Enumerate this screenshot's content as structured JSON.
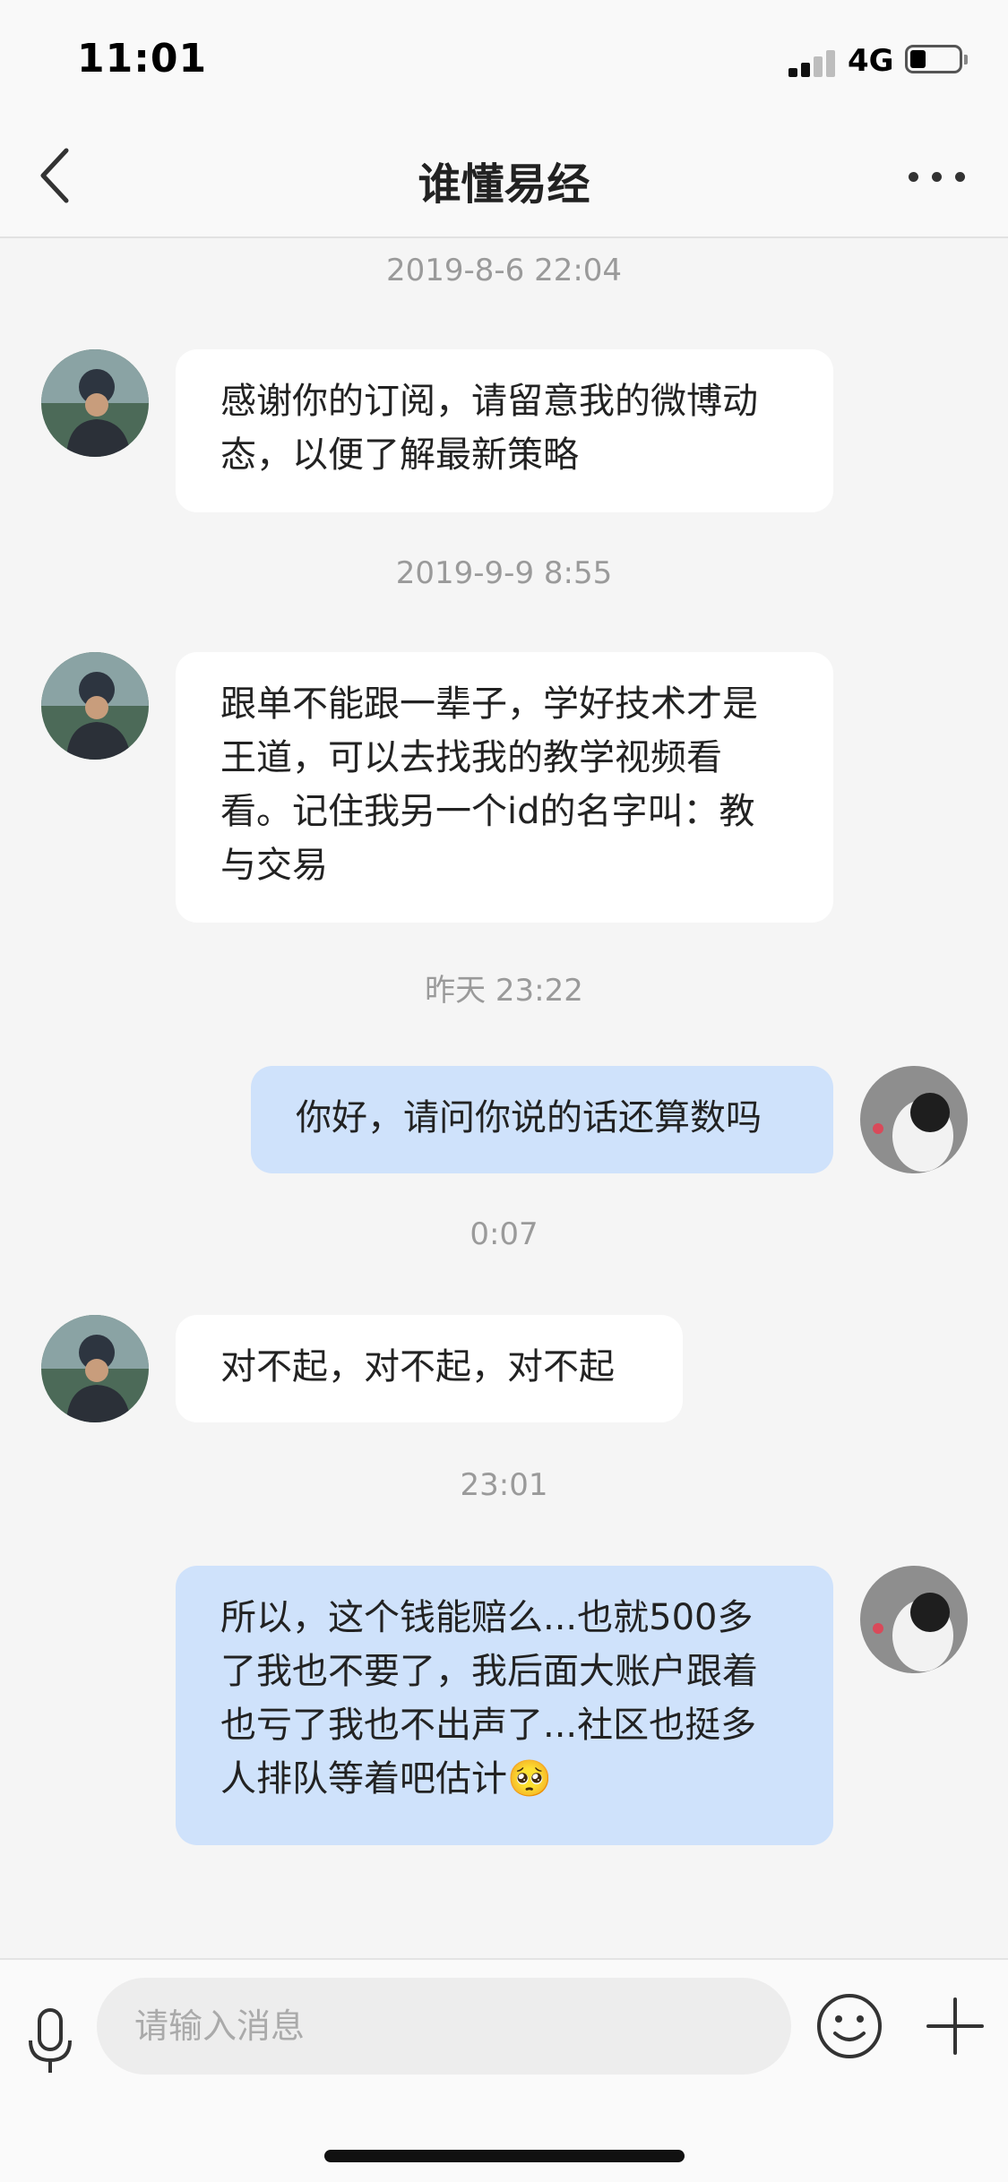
{
  "status_bar": {
    "time": "11:01",
    "network": "4G"
  },
  "nav": {
    "title": "谁懂易经"
  },
  "messages": [
    {
      "timestamp": "2019-8-6 22:04",
      "side": "left",
      "lines": [
        "感谢你的订阅，请留意我的微博动",
        "态，以便了解最新策略"
      ]
    },
    {
      "timestamp": "2019-9-9 8:55",
      "side": "left",
      "lines": [
        "跟单不能跟一辈子，学好技术才是",
        "王道，可以去找我的教学视频看",
        "看。记住我另一个id的名字叫：教",
        "与交易"
      ]
    },
    {
      "timestamp": "昨天 23:22",
      "side": "right",
      "lines": [
        "你好，请问你说的话还算数吗"
      ]
    },
    {
      "timestamp": "0:07",
      "side": "left",
      "lines": [
        "对不起，对不起，对不起"
      ]
    },
    {
      "timestamp": "23:01",
      "side": "right",
      "lines": [
        "所以，这个钱能赔么...也就500多",
        "了我也不要了，我后面大账户跟着",
        "也亏了我也不出声了...社区也挺多",
        "人排队等着吧估计🥺"
      ]
    }
  ],
  "input": {
    "placeholder": "请输入消息"
  },
  "icons": {
    "back": "chevron-left-icon",
    "more": "more-dots-icon",
    "mic": "microphone-icon",
    "emoji": "emoji-icon",
    "plus": "plus-icon"
  }
}
